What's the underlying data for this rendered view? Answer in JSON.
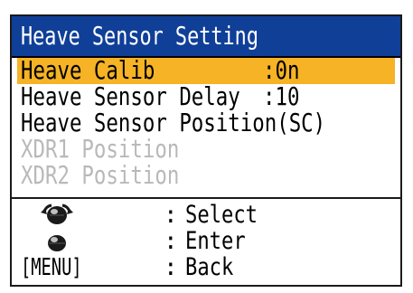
{
  "title": "Heave Sensor Setting",
  "menu_items": [
    {
      "label": "Heave Calib",
      "value": ":0n",
      "selected": true,
      "enabled": true
    },
    {
      "label": "Heave Sensor Delay",
      "value": ":10",
      "selected": false,
      "enabled": true
    },
    {
      "label": "Heave Sensor Position(SC)",
      "value": "",
      "selected": false,
      "enabled": true
    },
    {
      "label": "XDR1 Position",
      "value": "",
      "selected": false,
      "enabled": false
    },
    {
      "label": "XDR2 Position",
      "value": "",
      "selected": false,
      "enabled": false
    }
  ],
  "help": [
    {
      "icon": "rotary-knob-rotate-icon",
      "key": "",
      "colon": ":",
      "action": "Select"
    },
    {
      "icon": "rotary-knob-press-icon",
      "key": "",
      "colon": ":",
      "action": "Enter"
    },
    {
      "icon": "",
      "key": "[MENU]",
      "colon": ":",
      "action": "Back"
    }
  ],
  "colors": {
    "title_bg": "#103f98",
    "title_fg": "#ffffff",
    "highlight": "#f5b325",
    "disabled_text": "#b9b9b9"
  }
}
